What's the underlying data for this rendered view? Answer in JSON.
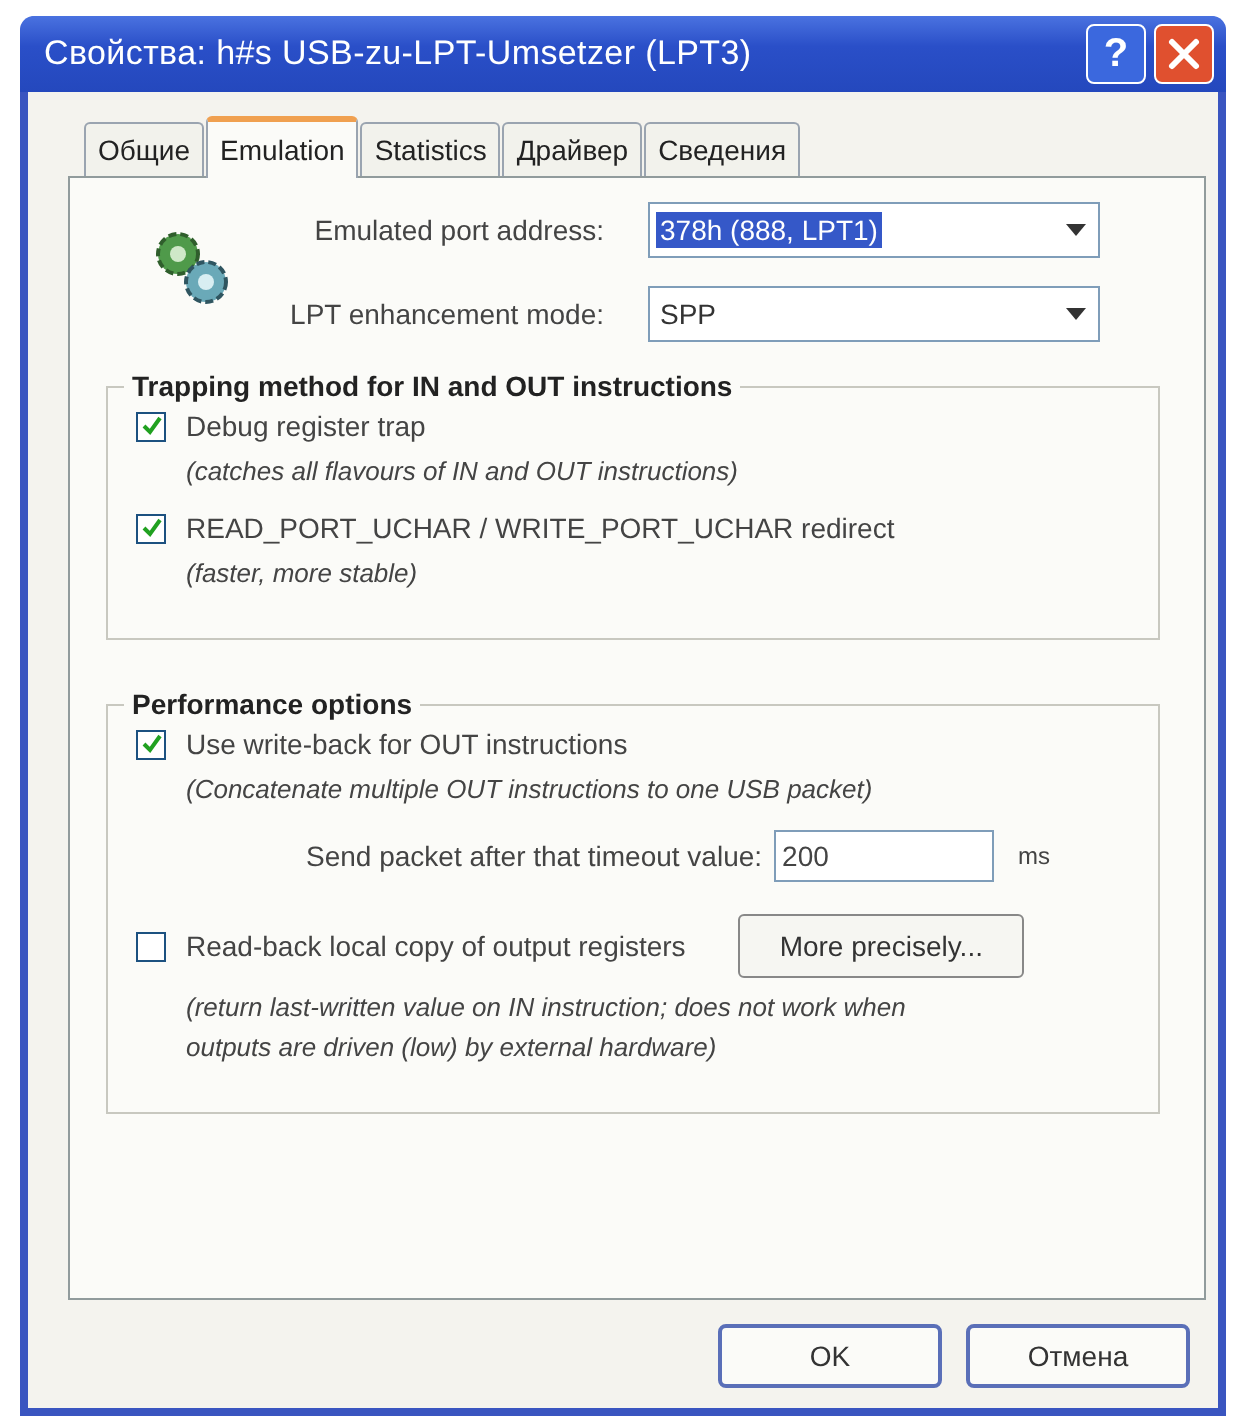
{
  "window": {
    "title": "Свойства: h#s USB-zu-LPT-Umsetzer (LPT3)",
    "help_glyph": "?"
  },
  "tabs": [
    {
      "label": "Общие",
      "selected": false
    },
    {
      "label": "Emulation",
      "selected": true
    },
    {
      "label": "Statistics",
      "selected": false
    },
    {
      "label": "Драйвер",
      "selected": false
    },
    {
      "label": "Сведения",
      "selected": false
    }
  ],
  "settings": [
    {
      "label": "Emulated port address:",
      "value": "378h (888, LPT1)",
      "text_selected": true
    },
    {
      "label": "LPT enhancement mode:",
      "value": "SPP",
      "text_selected": false
    }
  ],
  "groups": [
    {
      "title": "Trapping method for IN and OUT instructions",
      "items": [
        {
          "kind": "checkbox",
          "label": "Debug register trap",
          "checked": true,
          "note": "(catches all flavours of IN and OUT instructions)"
        },
        {
          "kind": "checkbox",
          "label": "READ_PORT_UCHAR / WRITE_PORT_UCHAR redirect",
          "checked": true,
          "note": "(faster, more stable)"
        }
      ]
    },
    {
      "title": "Performance options",
      "items": [
        {
          "kind": "checkbox",
          "label": "Use write-back for OUT instructions",
          "checked": true,
          "note": "(Concatenate multiple OUT instructions to one USB packet)"
        },
        {
          "kind": "timeout",
          "label": "Send packet after that timeout value:",
          "value": "200",
          "unit": "ms"
        },
        {
          "kind": "checkbox",
          "label": "Read-back local copy of output registers",
          "checked": false,
          "button": "More precisely...",
          "note": "(return last-written value on IN instruction; does not work when outputs are driven (low) by external hardware)"
        }
      ]
    }
  ],
  "buttons": [
    "OK",
    "Отмена"
  ]
}
